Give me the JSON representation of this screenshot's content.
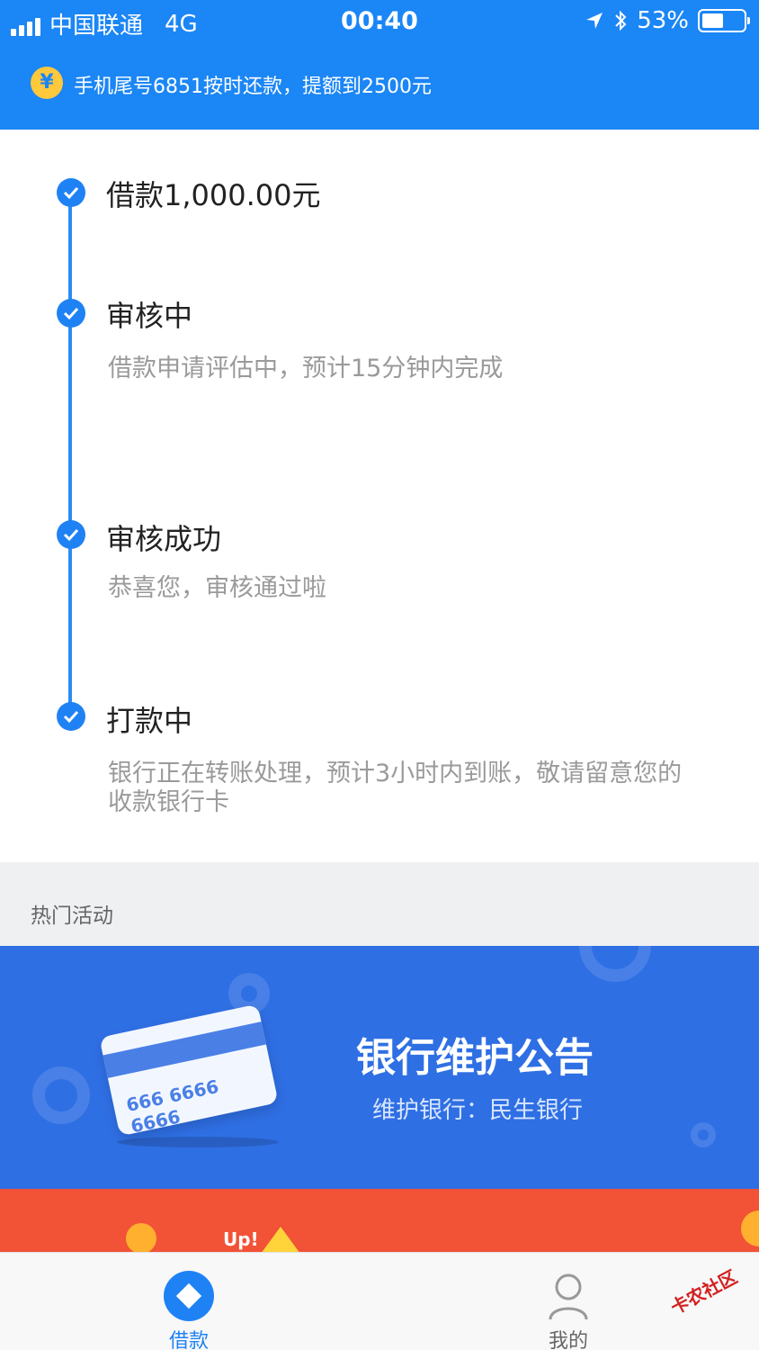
{
  "status_bar": {
    "carrier": "中国联通",
    "network": "4G",
    "time": "00:40",
    "battery": "53%",
    "battery_level": 0.53
  },
  "banner": {
    "coin_symbol": "¥",
    "text": "手机尾号6851按时还款，提额到2500元"
  },
  "timeline": {
    "steps": [
      {
        "title": "借款1,000.00元",
        "desc": ""
      },
      {
        "title": "审核中",
        "desc": "借款申请评估中，预计15分钟内完成"
      },
      {
        "title": "审核成功",
        "desc": "恭喜您，审核通过啦"
      },
      {
        "title": "打款中",
        "desc": "银行正在转账处理，预计3小时内到账，敬请留意您的收款银行卡"
      }
    ]
  },
  "hot_section": {
    "title": "热门活动"
  },
  "promo_bank": {
    "title": "银行维护公告",
    "subtitle": "维护银行：民生银行",
    "card_number": "666 6666 6666"
  },
  "promo_red": {
    "text": "Up!"
  },
  "tabbar": {
    "tabs": [
      {
        "label": "借款",
        "active": true
      },
      {
        "label": "我的",
        "active": false
      }
    ]
  },
  "watermark": "卡农社区",
  "colors": {
    "primary": "#1b86f5",
    "banner_blue": "#2f6fe4",
    "red": "#f25236"
  }
}
